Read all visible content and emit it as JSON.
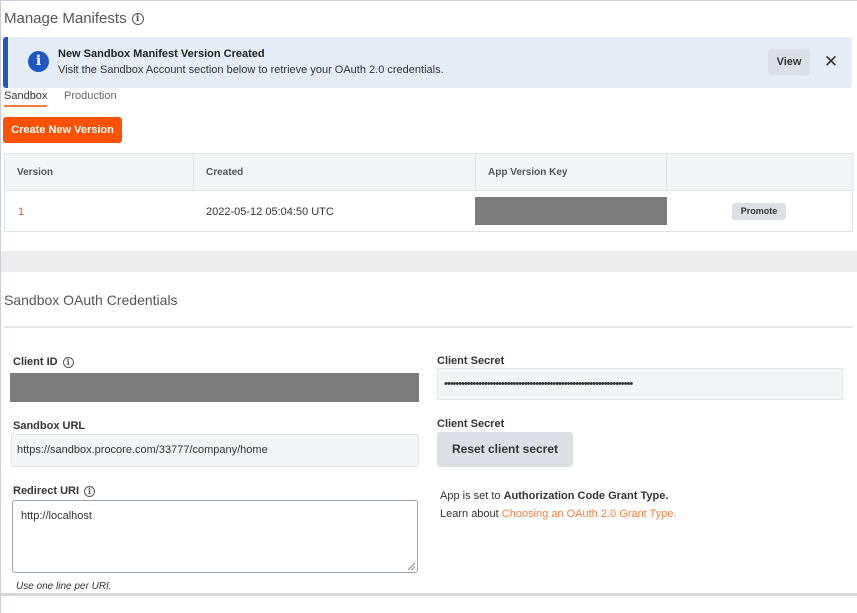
{
  "page": {
    "title": "Manage Manifests"
  },
  "banner": {
    "title": "New Sandbox Manifest Version Created",
    "message": "Visit the Sandbox Account section below to retrieve your OAuth 2.0 credentials.",
    "view_label": "View",
    "close_glyph": "✕",
    "info_glyph": "i",
    "accent_color": "#2157c4"
  },
  "tabs": [
    {
      "label": "Sandbox",
      "active": true
    },
    {
      "label": "Production",
      "active": false
    }
  ],
  "create_button": {
    "label": "Create New Version",
    "color": "#ff5200"
  },
  "versions_table": {
    "columns": [
      "Version",
      "Created",
      "App Version Key",
      ""
    ],
    "rows": [
      {
        "version": "1",
        "created": "2022-05-12 05:04:50 UTC",
        "app_version_key": "",
        "action": "Promote"
      }
    ]
  },
  "credentials": {
    "title": "Sandbox OAuth Credentials",
    "client_id_label": "Client ID",
    "client_id_value": "",
    "client_secret_label": "Client Secret",
    "client_secret_value": "••••••••••••••••••••••••••••••••••••••••••••••••••••••••••••••••••",
    "sandbox_url_label": "Sandbox URL",
    "sandbox_url_value": "https://sandbox.procore.com/33777/company/home",
    "reset_label": "Client Secret",
    "reset_button": "Reset client secret",
    "redirect_uri_label": "Redirect URI",
    "redirect_uri_value": "http://localhost",
    "redirect_hint": "Use one line per URI.",
    "grant_prefix": "App is set to",
    "grant_type": "Authorization Code Grant Type.",
    "learn_prefix": "Learn about",
    "learn_link": "Choosing an OAuth 2.0 Grant Type."
  }
}
